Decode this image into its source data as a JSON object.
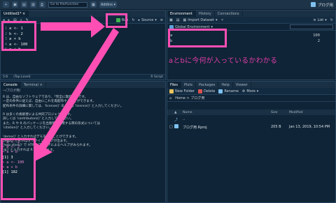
{
  "topbar": {
    "goto_placeholder": "Go to file/function",
    "addins_label": "Addins",
    "project_label": "ブログ用"
  },
  "source": {
    "tab_label": "Untitled1*",
    "run_label": "Run",
    "source_label": "Source",
    "code_lines": [
      "a <- 1",
      "b <- 2",
      "a + b",
      "a <- 100",
      "a + b"
    ],
    "status_pos": "5:6",
    "status_level": "(Top Level)",
    "status_type": "R Script"
  },
  "console": {
    "tabs": [
      "Console",
      "Terminal"
    ],
    "path": "~/ブログ用/",
    "lines": [
      "R は、自由なソフトウェアであり、「完全に無保証」です。",
      "一定の条件に従えば、自由にこれを再配布することができます。",
      "配布条件の詳細に関しては、'license()' あるいは 'licence()' と入力してください。",
      "",
      "R は多くの貢献者による共同プロジェクトです。",
      "詳しくは 'contributors()' と入力してください。",
      "また、R や R のパッケージを出版物で引用する際の形式については",
      "'citation()' と入力してください。",
      "",
      "'demo()' と入力すればデモをみることができます。",
      "'help()' とすればオンラインヘルプが出ます。",
      "'help.start()' で HTML ブラウザによるヘルプがみられます。",
      "'q()' と入力すれば R を終了します。"
    ],
    "output": [
      {
        "text": "> a <- 1",
        "kind": "prompt"
      },
      {
        "text": "> b <- 2",
        "kind": "prompt"
      },
      {
        "text": "> a + b",
        "kind": "prompt"
      },
      {
        "text": "[1] 3",
        "kind": "res"
      },
      {
        "text": "> a <- 100",
        "kind": "prompt"
      },
      {
        "text": "> a + b",
        "kind": "prompt"
      },
      {
        "text": "[1] 102",
        "kind": "res"
      }
    ]
  },
  "environment": {
    "tabs": [
      "Environment",
      "History",
      "Connections"
    ],
    "import_label": "Import Dataset",
    "list_label": "List",
    "scope_label": "Global Environment",
    "rows": [
      {
        "name": "a",
        "value": "100"
      },
      {
        "name": "b",
        "value": "2"
      }
    ],
    "annotation": "aとbに今何が入っているかわかる"
  },
  "files": {
    "tabs": [
      "Files",
      "Plots",
      "Packages",
      "Help",
      "Viewer"
    ],
    "new_folder": "New Folder",
    "delete": "Delete",
    "rename": "Rename",
    "more": "More",
    "breadcrumb": "Home > ブログ用",
    "headers": {
      "name": "Name",
      "size": "Size",
      "modified": "Modified"
    },
    "parent": "..",
    "rows": [
      {
        "name": "ブログ用.Rproj",
        "size": "205 B",
        "modified": "Jan 13, 2019, 10:54 PM"
      }
    ]
  },
  "colors": {
    "highlight": "#ff4fb4",
    "background": "#0f2436"
  }
}
